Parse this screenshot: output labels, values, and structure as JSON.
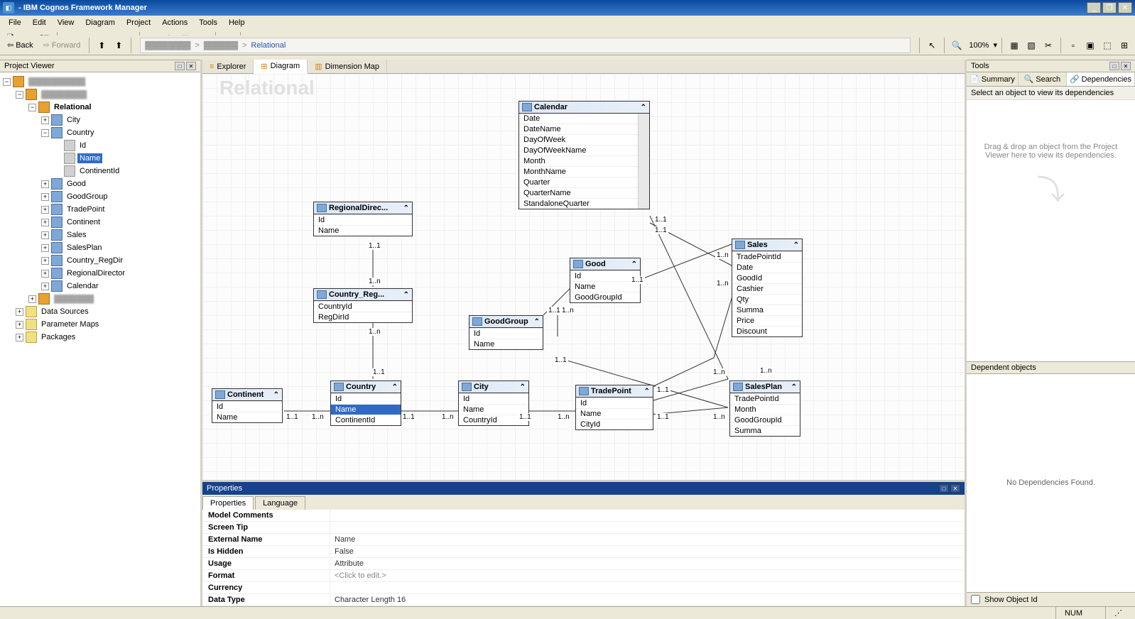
{
  "title": "- IBM Cognos Framework Manager",
  "menus": [
    "File",
    "Edit",
    "View",
    "Diagram",
    "Project",
    "Actions",
    "Tools",
    "Help"
  ],
  "toolbar": {
    "undo": "Undo",
    "redo": "Redo",
    "back": "Back",
    "forward": "Forward",
    "zoom": "100%"
  },
  "breadcrumb": {
    "current": "Relational",
    "sep": ">"
  },
  "projectViewer": {
    "title": "Project Viewer",
    "tree": {
      "relational": "Relational",
      "city": "City",
      "country": "Country",
      "id": "Id",
      "name": "Name",
      "continentId": "ContinentId",
      "good": "Good",
      "goodGroup": "GoodGroup",
      "tradePoint": "TradePoint",
      "continent": "Continent",
      "sales": "Sales",
      "salesPlan": "SalesPlan",
      "countryRegDir": "Country_RegDir",
      "regionalDirector": "RegionalDirector",
      "calendar": "Calendar",
      "dataSources": "Data Sources",
      "parameterMaps": "Parameter Maps",
      "packages": "Packages"
    }
  },
  "viewTabs": {
    "explorer": "Explorer",
    "diagram": "Diagram",
    "dimensionMap": "Dimension Map"
  },
  "watermark": "Relational",
  "entities": {
    "Calendar": {
      "title": "Calendar",
      "attrs": [
        "Date",
        "DateName",
        "DayOfWeek",
        "DayOfWeekName",
        "Month",
        "MonthName",
        "Quarter",
        "QuarterName",
        "StandaloneQuarter"
      ]
    },
    "RegionalDirector": {
      "title": "RegionalDirec...",
      "attrs": [
        "Id",
        "Name"
      ]
    },
    "CountryReg": {
      "title": "Country_Reg...",
      "attrs": [
        "CountryId",
        "RegDirId"
      ]
    },
    "Good": {
      "title": "Good",
      "attrs": [
        "Id",
        "Name",
        "GoodGroupId"
      ]
    },
    "GoodGroup": {
      "title": "GoodGroup",
      "attrs": [
        "Id",
        "Name"
      ]
    },
    "Sales": {
      "title": "Sales",
      "attrs": [
        "TradePointId",
        "Date",
        "GoodId",
        "Cashier",
        "Qty",
        "Summa",
        "Price",
        "Discount"
      ]
    },
    "Continent": {
      "title": "Continent",
      "attrs": [
        "Id",
        "Name"
      ]
    },
    "Country": {
      "title": "Country",
      "attrs": [
        "Id",
        "Name",
        "ContinentId"
      ]
    },
    "City": {
      "title": "City",
      "attrs": [
        "Id",
        "Name",
        "CountryId"
      ]
    },
    "TradePoint": {
      "title": "TradePoint",
      "attrs": [
        "Id",
        "Name",
        "CityId"
      ]
    },
    "SalesPlan": {
      "title": "SalesPlan",
      "attrs": [
        "TradePointId",
        "Month",
        "GoodGroupId",
        "Summa"
      ]
    }
  },
  "cardinalities": {
    "c1": "1..1",
    "cn": "1..n"
  },
  "properties": {
    "panelTitle": "Properties",
    "tabProps": "Properties",
    "tabLang": "Language",
    "rows": [
      {
        "k": "Model Comments",
        "v": ""
      },
      {
        "k": "Screen Tip",
        "v": ""
      },
      {
        "k": "External Name",
        "v": "Name"
      },
      {
        "k": "Is Hidden",
        "v": "False"
      },
      {
        "k": "Usage",
        "v": "Attribute"
      },
      {
        "k": "Format",
        "v": "<Click to edit.>"
      },
      {
        "k": "Currency",
        "v": ""
      },
      {
        "k": "Data Type",
        "v": "Character Length 16"
      }
    ]
  },
  "tools": {
    "title": "Tools",
    "tabs": {
      "summary": "Summary",
      "search": "Search",
      "dependencies": "Dependencies"
    },
    "selectObj": "Select an object to view its dependencies",
    "hint": "Drag & drop an object from the Project Viewer here to view its dependencies.",
    "depHeader": "Dependent objects",
    "depNone": "No Dependencies Found.",
    "showObjId": "Show Object Id"
  },
  "status": {
    "num": "NUM"
  }
}
